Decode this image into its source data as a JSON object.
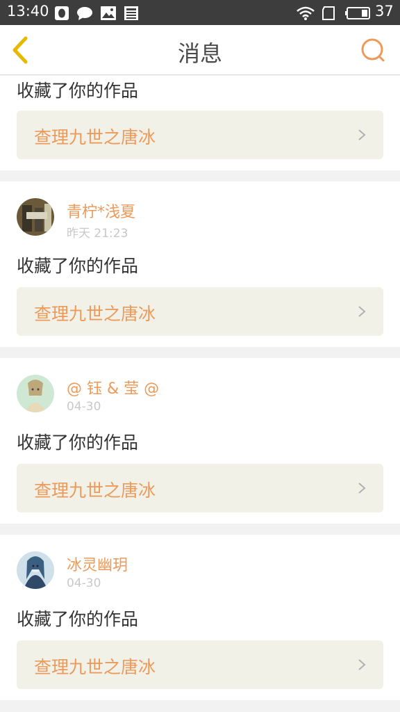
{
  "status_bar": {
    "time": "13:40",
    "battery": "37",
    "icons": [
      "qq-icon",
      "chat-bubble-icon",
      "image-icon",
      "news-icon",
      "wifi-icon",
      "sim-icon",
      "battery-icon"
    ]
  },
  "header": {
    "title": "消息",
    "back_icon": "chevron-left-icon",
    "search_icon": "search-icon"
  },
  "colors": {
    "accent": "#ec9a5a",
    "status_bar_bg": "#3d3d3d",
    "back_icon": "#e6b800",
    "work_bg": "#f2f1e8",
    "separator": "#f2f2f2"
  },
  "notifications": [
    {
      "user": "",
      "time": "",
      "action": "收藏了你的作品",
      "work": "查理九世之唐冰"
    },
    {
      "user": "青柠*浅夏",
      "time": "昨天 21:23",
      "action": "收藏了你的作品",
      "work": "查理九世之唐冰"
    },
    {
      "user": "@ 钰 & 莹 @",
      "time": "04-30",
      "action": "收藏了你的作品",
      "work": "查理九世之唐冰"
    },
    {
      "user": "冰灵幽玥",
      "time": "04-30",
      "action": "收藏了你的作品",
      "work": "查理九世之唐冰"
    }
  ]
}
